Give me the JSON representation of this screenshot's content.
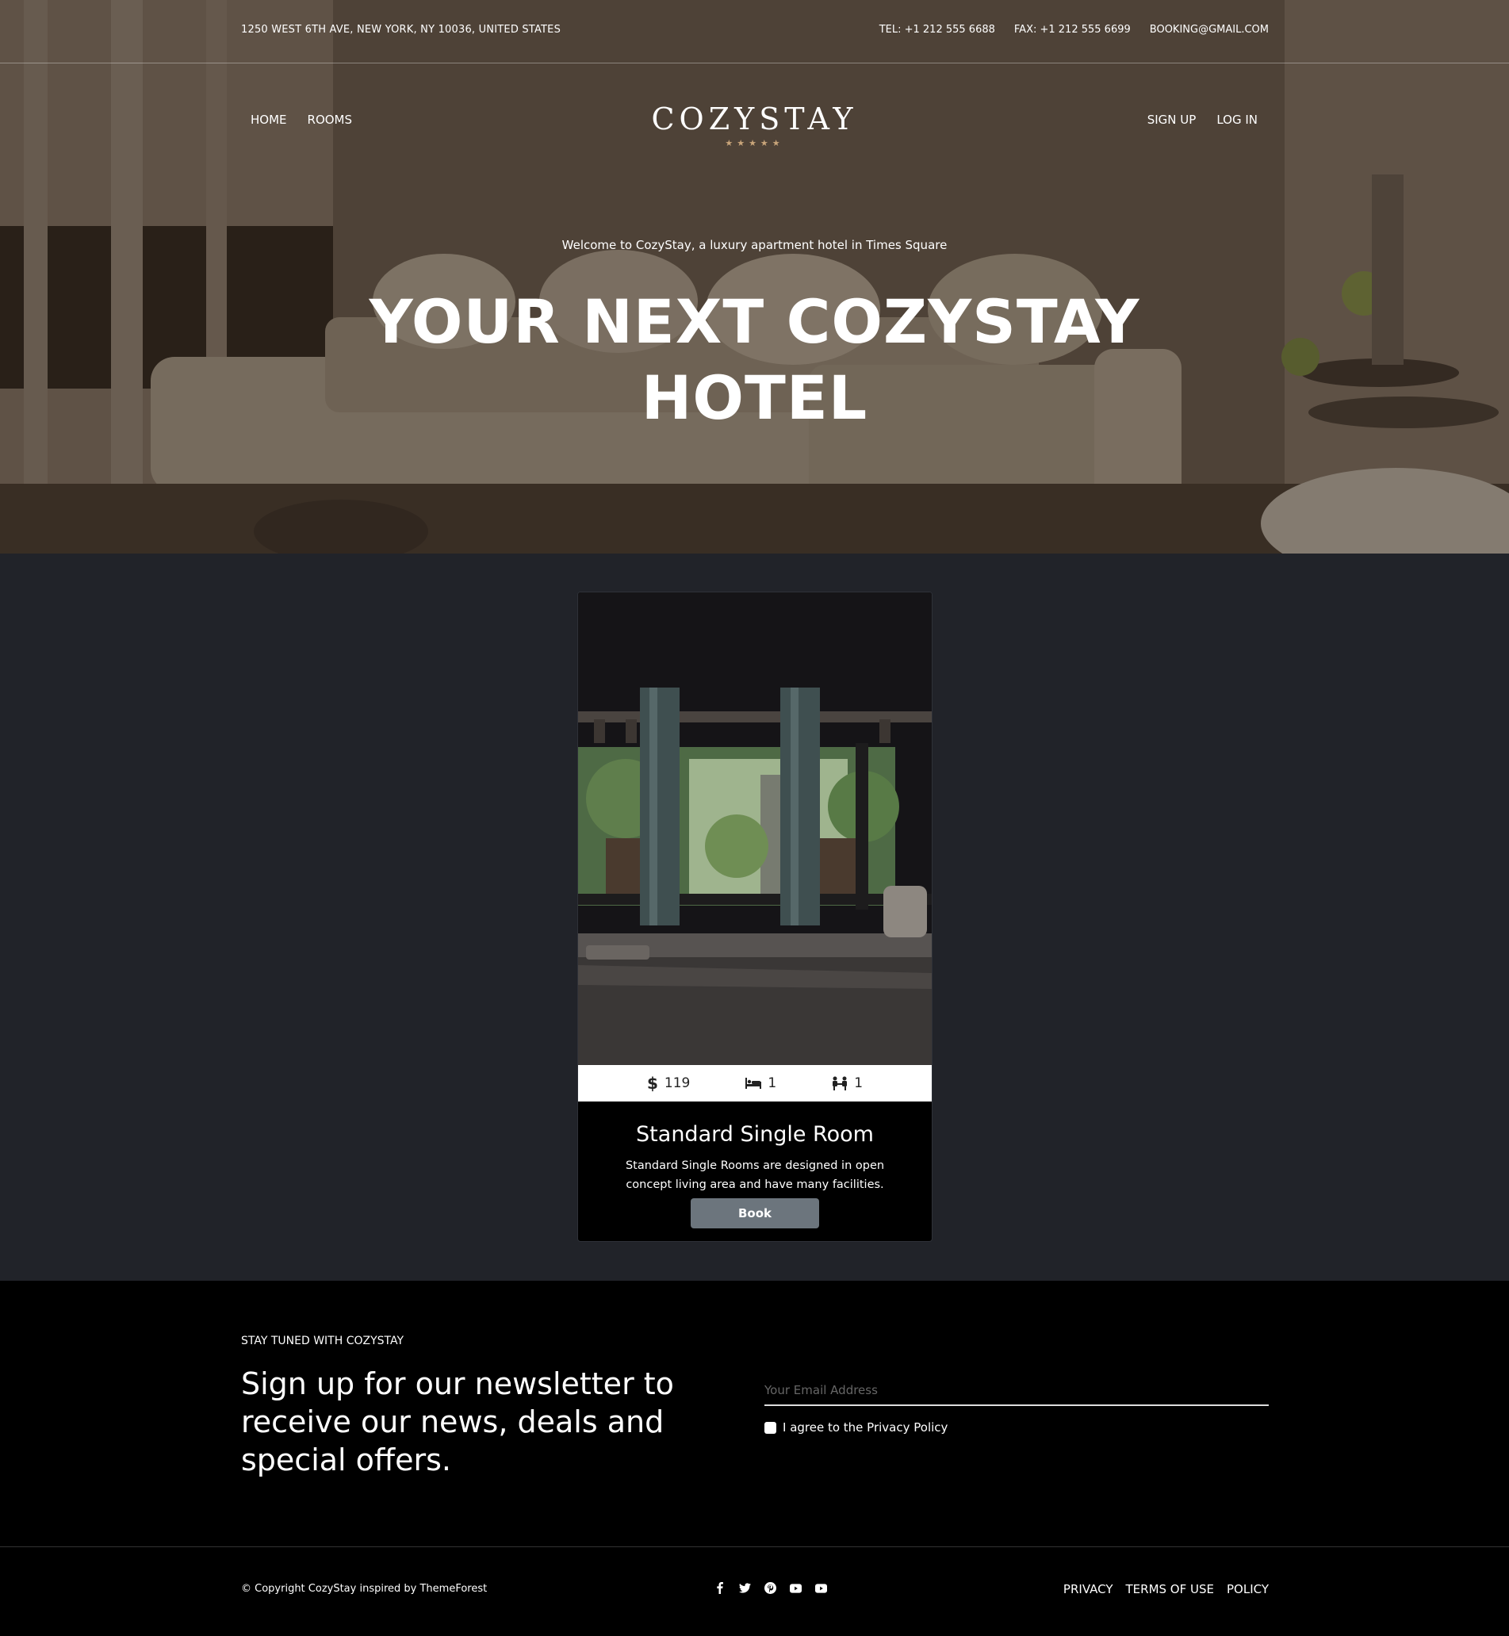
{
  "topbar": {
    "address": "1250 WEST 6TH AVE, NEW YORK, NY 10036, UNITED STATES",
    "tel": "TEL: +1 212 555 6688",
    "fax": "FAX: +1 212 555 6699",
    "email": "BOOKING@GMAIL.COM"
  },
  "nav": {
    "left": [
      "HOME",
      "ROOMS"
    ],
    "right": [
      "SIGN UP",
      "LOG IN"
    ],
    "logo": "COZYSTAY",
    "stars": "★★★★★"
  },
  "hero": {
    "welcome": "Welcome to CozyStay, a luxury apartment hotel in Times Square",
    "title_line1": "YOUR NEXT COZYSTAY",
    "title_line2": "HOTEL"
  },
  "room_card": {
    "price": "119",
    "beds": "1",
    "guests": "1",
    "title": "Standard Single Room",
    "description": "Standard Single Rooms are designed in open concept living area and have many facilities.",
    "button": "Book"
  },
  "newsletter": {
    "kicker": "STAY TUNED WITH COZYSTAY",
    "heading": "Sign up for our newsletter to receive our news, deals and special offers.",
    "email_placeholder": "Your Email Address",
    "agree": "I agree to the Privacy Policy"
  },
  "footer": {
    "copyright": "© Copyright CozyStay inspired by ThemeForest",
    "links": [
      "PRIVACY",
      "TERMS OF USE",
      "POLICY"
    ],
    "social": [
      "facebook-icon",
      "twitter-icon",
      "pinterest-icon",
      "youtube-icon",
      "youtube-icon"
    ]
  },
  "colors": {
    "accent_star": "#c9a57a",
    "mid_bg": "#212329",
    "button": "#6c757d"
  }
}
